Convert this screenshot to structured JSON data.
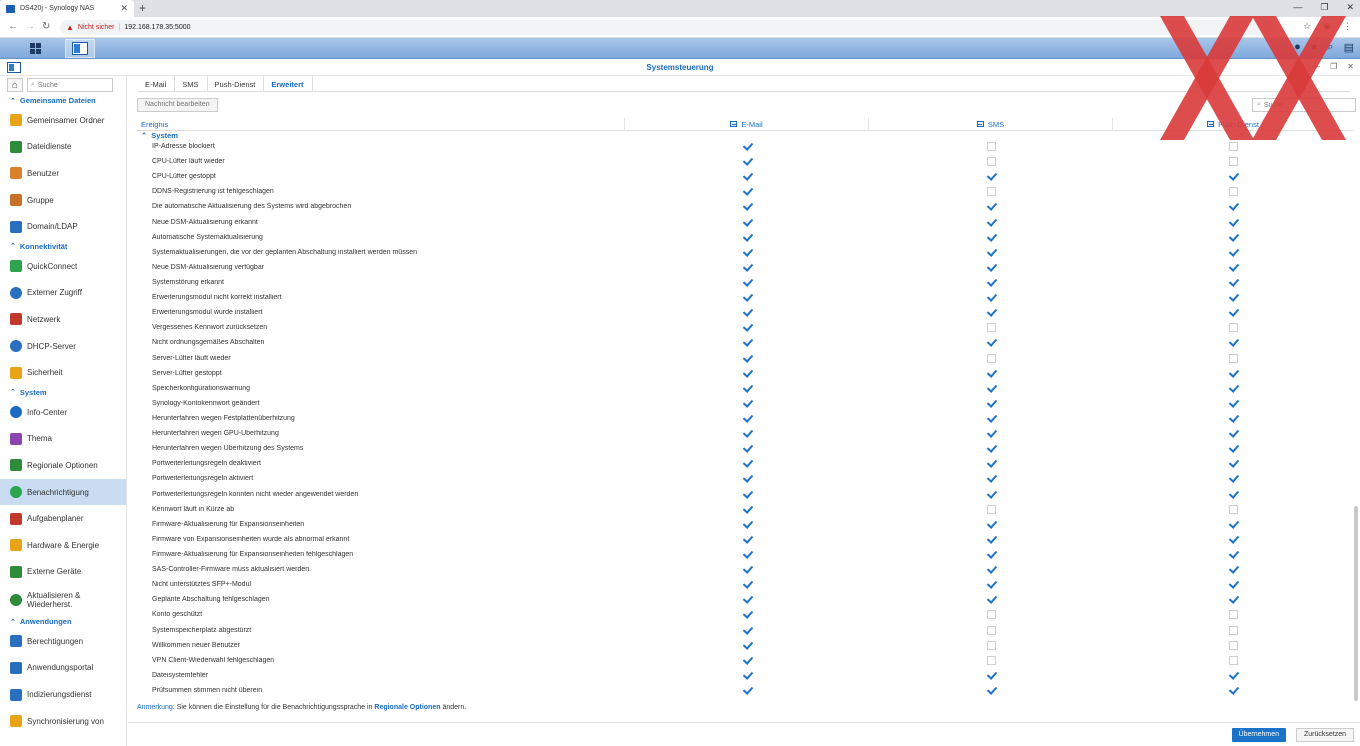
{
  "browser": {
    "tab_title": "DS420j - Synology NAS",
    "not_secure": "Nicht sicher",
    "url": "192.168.178.35:5000"
  },
  "window": {
    "title": "Systemsteuerung"
  },
  "sidebar": {
    "search_placeholder": "Suche",
    "entries": [
      {
        "kind": "section",
        "label": "Gemeinsame Dateien"
      },
      {
        "kind": "item",
        "label": "Gemeinsamer Ordner",
        "icon": "folder-icon",
        "color": "#e8a317"
      },
      {
        "kind": "item",
        "label": "Dateidienste",
        "icon": "file-services-icon",
        "color": "#2e8b3a"
      },
      {
        "kind": "item",
        "label": "Benutzer",
        "icon": "user-icon",
        "color": "#d9822b"
      },
      {
        "kind": "item",
        "label": "Gruppe",
        "icon": "group-icon",
        "color": "#c96f2c"
      },
      {
        "kind": "item",
        "label": "Domain/LDAP",
        "icon": "domain-icon",
        "color": "#2a6fbf"
      },
      {
        "kind": "section",
        "label": "Konnektivität"
      },
      {
        "kind": "item",
        "label": "QuickConnect",
        "icon": "quickconnect-icon",
        "color": "#2ea44f"
      },
      {
        "kind": "item",
        "label": "Externer Zugriff",
        "icon": "globe-icon",
        "color": "#2a6fbf"
      },
      {
        "kind": "item",
        "label": "Netzwerk",
        "icon": "network-icon",
        "color": "#c0392b"
      },
      {
        "kind": "item",
        "label": "DHCP-Server",
        "icon": "dhcp-icon",
        "color": "#2a6fbf"
      },
      {
        "kind": "item",
        "label": "Sicherheit",
        "icon": "shield-icon",
        "color": "#e8a317"
      },
      {
        "kind": "section",
        "label": "System"
      },
      {
        "kind": "item",
        "label": "Info-Center",
        "icon": "info-icon",
        "color": "#1a6cc2"
      },
      {
        "kind": "item",
        "label": "Thema",
        "icon": "theme-icon",
        "color": "#8e44ad"
      },
      {
        "kind": "item",
        "label": "Regionale Optionen",
        "icon": "region-icon",
        "color": "#2e8b3a"
      },
      {
        "kind": "item",
        "label": "Benachrichtigung",
        "icon": "notification-icon",
        "color": "#2ea44f",
        "active": true
      },
      {
        "kind": "item",
        "label": "Aufgabenplaner",
        "icon": "task-icon",
        "color": "#c0392b"
      },
      {
        "kind": "item",
        "label": "Hardware & Energie",
        "icon": "hardware-icon",
        "color": "#e8a317"
      },
      {
        "kind": "item",
        "label": "Externe Geräte",
        "icon": "device-icon",
        "color": "#2e8b3a"
      },
      {
        "kind": "item",
        "label": "Aktualisieren & Wiederherst.",
        "icon": "update-icon",
        "color": "#2e8b3a",
        "tall": true
      },
      {
        "kind": "section",
        "label": "Anwendungen"
      },
      {
        "kind": "item",
        "label": "Berechtigungen",
        "icon": "permissions-icon",
        "color": "#2a6fbf"
      },
      {
        "kind": "item",
        "label": "Anwendungsportal",
        "icon": "portal-icon",
        "color": "#2a6fbf"
      },
      {
        "kind": "item",
        "label": "Indizierungsdienst",
        "icon": "index-icon",
        "color": "#2a6fbf"
      },
      {
        "kind": "item",
        "label": "Synchronisierung von",
        "icon": "sync-icon",
        "color": "#e8a317"
      }
    ]
  },
  "tabs": [
    {
      "label": "E-Mail",
      "active": false
    },
    {
      "label": "SMS",
      "active": false
    },
    {
      "label": "Push-Dienst",
      "active": false
    },
    {
      "label": "Erweitert",
      "active": true
    }
  ],
  "toolbar": {
    "edit_label": "Nachricht bearbeiten",
    "search_placeholder": "Suche"
  },
  "table": {
    "columns": [
      "Ereignis",
      "E-Mail",
      "SMS",
      "Push-Dienst"
    ],
    "group": "System",
    "rows": [
      {
        "event": "IP-Adresse blockiert",
        "checks": [
          true,
          false,
          false
        ]
      },
      {
        "event": "CPU-Lüfter läuft wieder",
        "checks": [
          true,
          false,
          false
        ]
      },
      {
        "event": "CPU-Lüfter gestoppt",
        "checks": [
          true,
          true,
          true
        ]
      },
      {
        "event": "DDNS-Registrierung ist fehlgeschlagen",
        "checks": [
          true,
          false,
          false
        ]
      },
      {
        "event": "Die automatische Aktualisierung des Systems wird abgebrochen",
        "checks": [
          true,
          true,
          true
        ]
      },
      {
        "event": "Neue DSM-Aktualisierung erkannt",
        "checks": [
          true,
          true,
          true
        ]
      },
      {
        "event": "Automatische Systemaktualisierung",
        "checks": [
          true,
          true,
          true
        ]
      },
      {
        "event": "Systemaktualisierungen, die vor der geplanten Abschaltung installiert werden müssen",
        "checks": [
          true,
          true,
          true
        ]
      },
      {
        "event": "Neue DSM-Aktualisierung verfügbar",
        "checks": [
          true,
          true,
          true
        ]
      },
      {
        "event": "Systemstörung erkannt",
        "checks": [
          true,
          true,
          true
        ]
      },
      {
        "event": "Erweiterungsmodul nicht korrekt installiert",
        "checks": [
          true,
          true,
          true
        ]
      },
      {
        "event": "Erweiterungsmodul wurde installiert",
        "checks": [
          true,
          true,
          true
        ]
      },
      {
        "event": "Vergessenes Kennwort zurücksetzen",
        "checks": [
          true,
          false,
          false
        ]
      },
      {
        "event": "Nicht ordnungsgemäßes Abschalten",
        "checks": [
          true,
          true,
          true
        ]
      },
      {
        "event": "Server-Lüfter läuft wieder",
        "checks": [
          true,
          false,
          false
        ]
      },
      {
        "event": "Server-Lüfter gestoppt",
        "checks": [
          true,
          true,
          true
        ]
      },
      {
        "event": "Speicherkonfigurationswarnung",
        "checks": [
          true,
          true,
          true
        ]
      },
      {
        "event": "Synology-Kontokennwort geändert",
        "checks": [
          true,
          true,
          true
        ]
      },
      {
        "event": "Herunterfahren wegen Festplattenüberhitzung",
        "checks": [
          true,
          true,
          true
        ]
      },
      {
        "event": "Herunterfahren wegen GPU-Überhitzung",
        "checks": [
          true,
          true,
          true
        ]
      },
      {
        "event": "Herunterfahren wegen Überhitzung des Systems",
        "checks": [
          true,
          true,
          true
        ]
      },
      {
        "event": "Portweiterleitungsregeln deaktiviert",
        "checks": [
          true,
          true,
          true
        ]
      },
      {
        "event": "Portweiterleitungsregeln aktiviert",
        "checks": [
          true,
          true,
          true
        ]
      },
      {
        "event": "Portweiterleitungsregeln konnten nicht wieder angewendet werden",
        "checks": [
          true,
          true,
          true
        ]
      },
      {
        "event": "Kennwort läuft in Kürze ab",
        "checks": [
          true,
          false,
          false
        ]
      },
      {
        "event": "Firmware-Aktualisierung für Expansionseinheiten",
        "checks": [
          true,
          true,
          true
        ]
      },
      {
        "event": "Firmware von Expansionseinheiten wurde als abnormal erkannt",
        "checks": [
          true,
          true,
          true
        ]
      },
      {
        "event": "Firmware-Aktualisierung für Expansionseinheiten fehlgeschlagen",
        "checks": [
          true,
          true,
          true
        ]
      },
      {
        "event": "SAS-Controller-Firmware muss aktualisiert werden.",
        "checks": [
          true,
          true,
          true
        ]
      },
      {
        "event": "Nicht unterstütztes SFP+-Modul",
        "checks": [
          true,
          true,
          true
        ]
      },
      {
        "event": "Geplante Abschaltung fehlgeschlagen",
        "checks": [
          true,
          true,
          true
        ]
      },
      {
        "event": "Konto geschützt",
        "checks": [
          true,
          false,
          false
        ]
      },
      {
        "event": "Systemspeicherplatz abgestürzt",
        "checks": [
          true,
          false,
          false
        ]
      },
      {
        "event": "Willkommen neuer Benutzer",
        "checks": [
          true,
          false,
          false
        ]
      },
      {
        "event": "VPN Client-Wiederwahl fehlgeschlagen",
        "checks": [
          true,
          false,
          false
        ]
      },
      {
        "event": "Dateisystemfehler",
        "checks": [
          true,
          true,
          true
        ]
      },
      {
        "event": "Prüfsummen stimmen nicht überein",
        "checks": [
          true,
          true,
          true
        ]
      }
    ]
  },
  "note": {
    "label": "Anmerkung:",
    "text": " Sie können die Einstellung für die Benachrichtigungssprache in ",
    "link": "Regionale Optionen",
    "suffix": " ändern."
  },
  "footer": {
    "apply_label": "Übernehmen",
    "reset_label": "Zurücksetzen"
  },
  "colors": {
    "accent": "#1a6cc2",
    "check": "#1f73c7",
    "overlay_x": "#d93a3a"
  }
}
